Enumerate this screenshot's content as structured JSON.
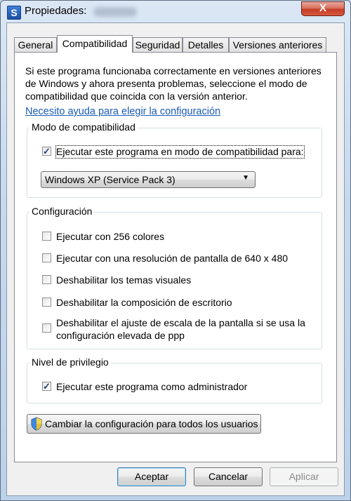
{
  "window": {
    "title": "Propiedades:",
    "app_icon": "S",
    "close_symbol": "X"
  },
  "tabs": [
    {
      "label": "General",
      "active": false
    },
    {
      "label": "Compatibilidad",
      "active": true
    },
    {
      "label": "Seguridad",
      "active": false
    },
    {
      "label": "Detalles",
      "active": false
    },
    {
      "label": "Versiones anteriores",
      "active": false
    }
  ],
  "description": "Si este programa funcionaba correctamente en versiones anteriores de Windows y ahora presenta problemas, seleccione el modo de compatibilidad que coincida con la versión anterior.",
  "help_link": "Necesito ayuda para elegir la configuración",
  "compat_mode": {
    "group_label": "Modo de compatibilidad",
    "checkbox_label": "Ejecutar este programa en modo de compatibilidad para:",
    "checked": true,
    "selected_os": "Windows XP (Service Pack 3)"
  },
  "settings": {
    "group_label": "Configuración",
    "options": [
      {
        "label": "Ejecutar con 256 colores",
        "checked": false
      },
      {
        "label": "Ejecutar con una resolución de pantalla de 640 x 480",
        "checked": false
      },
      {
        "label": "Deshabilitar los temas visuales",
        "checked": false
      },
      {
        "label": "Deshabilitar la composición de escritorio",
        "checked": false
      },
      {
        "label_line1": "Deshabilitar el ajuste de escala de la pantalla si se usa la",
        "label_line2": "configuración elevada de ppp",
        "checked": false
      }
    ]
  },
  "privilege": {
    "group_label": "Nivel de privilegio",
    "checkbox_label": "Ejecutar este programa como administrador",
    "checked": true
  },
  "change_all_button": "Cambiar la configuración para todos los usuarios",
  "footer": {
    "ok": "Aceptar",
    "cancel": "Cancelar",
    "apply": "Aplicar"
  },
  "check_mark": "✓",
  "dropdown_arrow": "▼"
}
